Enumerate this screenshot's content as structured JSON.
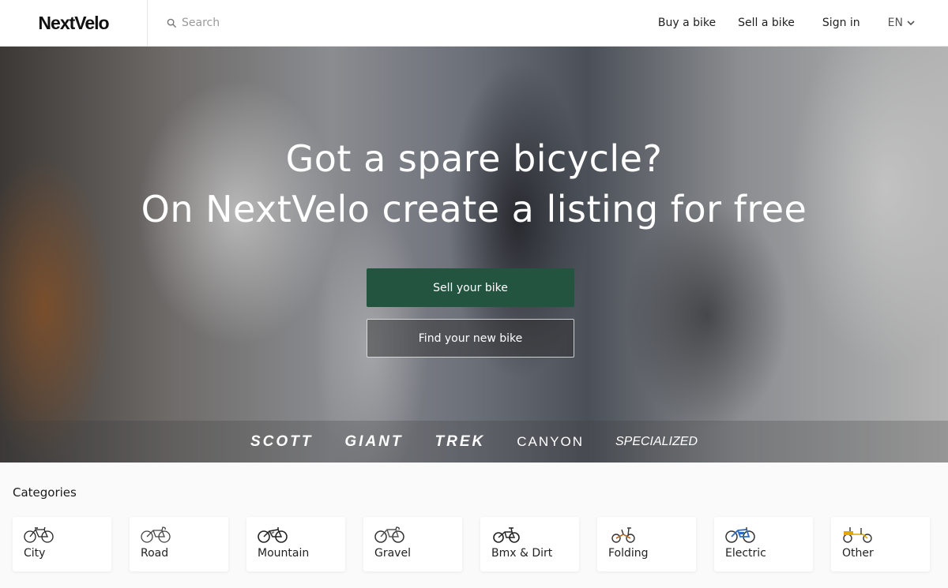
{
  "header": {
    "logo": "NextVelo",
    "search_placeholder": "Search",
    "nav": {
      "buy": "Buy a bike",
      "sell": "Sell a bike",
      "signin": "Sign in",
      "lang": "EN"
    }
  },
  "hero": {
    "title_line1": "Got a spare bicycle?",
    "title_line2": "On NextVelo create a listing for free",
    "primary_button": "Sell your bike",
    "secondary_button": "Find your new bike",
    "brands": [
      "SCOTT",
      "GIANT",
      "TREK",
      "CANYON",
      "SPECIALIZED"
    ]
  },
  "categories": {
    "title": "Categories",
    "items": [
      {
        "label": "City",
        "icon": "city-bike-icon"
      },
      {
        "label": "Road",
        "icon": "road-bike-icon"
      },
      {
        "label": "Mountain",
        "icon": "mountain-bike-icon"
      },
      {
        "label": "Gravel",
        "icon": "gravel-bike-icon"
      },
      {
        "label": "Bmx & Dirt",
        "icon": "bmx-bike-icon"
      },
      {
        "label": "Folding",
        "icon": "folding-bike-icon"
      },
      {
        "label": "Electric",
        "icon": "electric-bike-icon"
      },
      {
        "label": "Other",
        "icon": "cargo-bike-icon"
      }
    ]
  },
  "colors": {
    "primary_button": "#23543f",
    "header_bg": "#ffffff",
    "page_bg": "#fafafa"
  }
}
